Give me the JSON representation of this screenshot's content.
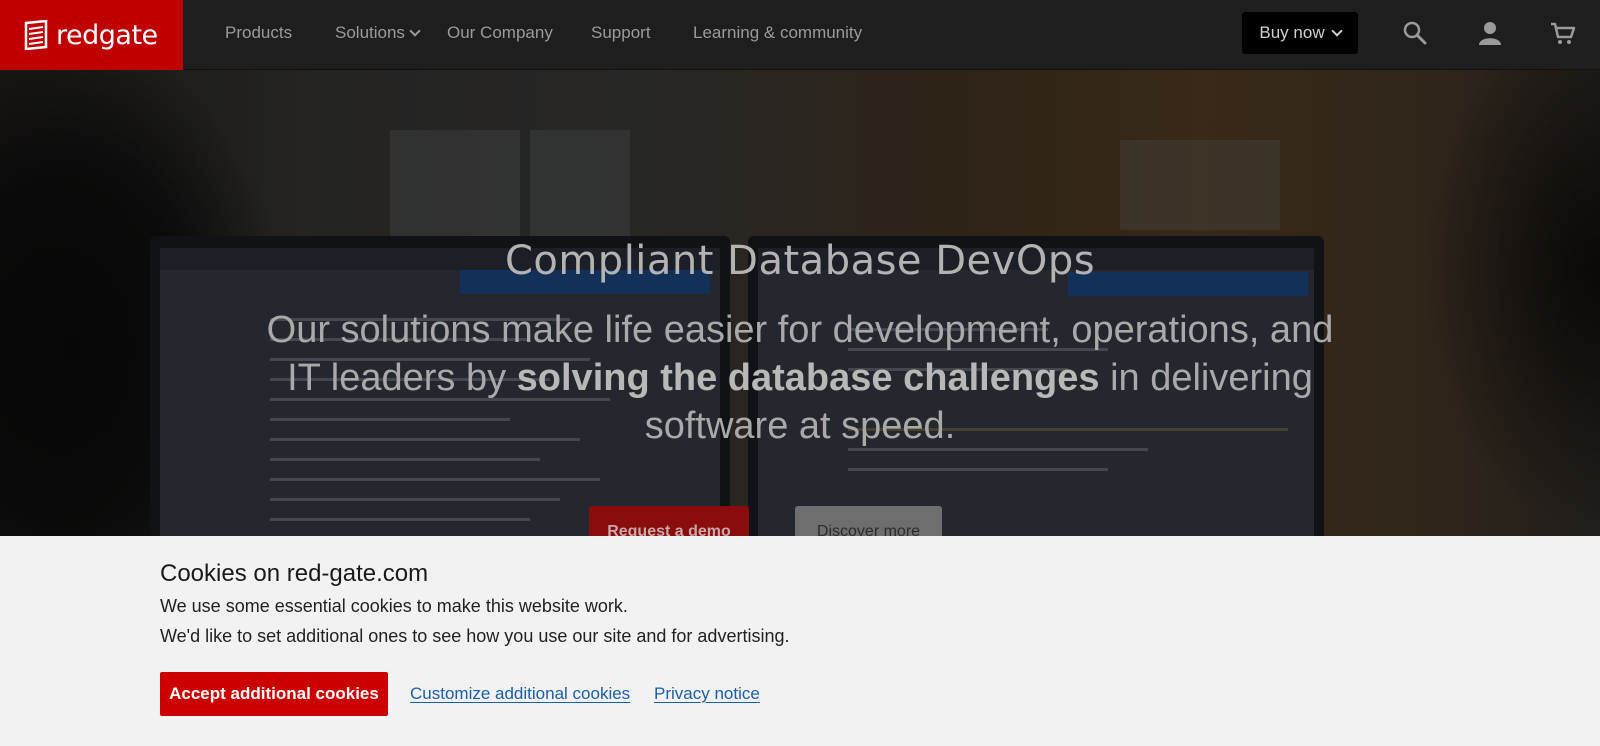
{
  "brand": {
    "name": "redgate",
    "color": "#c00000"
  },
  "nav": {
    "items": [
      {
        "label": "Products",
        "has_dropdown": false
      },
      {
        "label": "Solutions",
        "has_dropdown": true
      },
      {
        "label": "Our Company",
        "has_dropdown": false
      },
      {
        "label": "Support",
        "has_dropdown": false
      },
      {
        "label": "Learning & community",
        "has_dropdown": false
      }
    ],
    "buy_now_label": "Buy now",
    "icons": [
      "search-icon",
      "account-icon",
      "cart-icon"
    ]
  },
  "hero": {
    "title": "Compliant Database DevOps",
    "subtitle_before": "Our solutions make life easier for development, operations, and IT leaders by ",
    "subtitle_bold": "solving the database challenges",
    "subtitle_after": " in delivering software at speed.",
    "primary_cta": "Request a demo",
    "secondary_cta": "Discover more"
  },
  "cookie_banner": {
    "title": "Cookies on red-gate.com",
    "line1": "We use some essential cookies to make this website work.",
    "line2": "We'd like to set additional ones to see how you use our site and for advertising.",
    "accept_label": "Accept additional cookies",
    "customize_label": "Customize additional cookies",
    "privacy_label": "Privacy notice",
    "accent_color": "#cc0000",
    "link_color": "#1a5fa8"
  }
}
